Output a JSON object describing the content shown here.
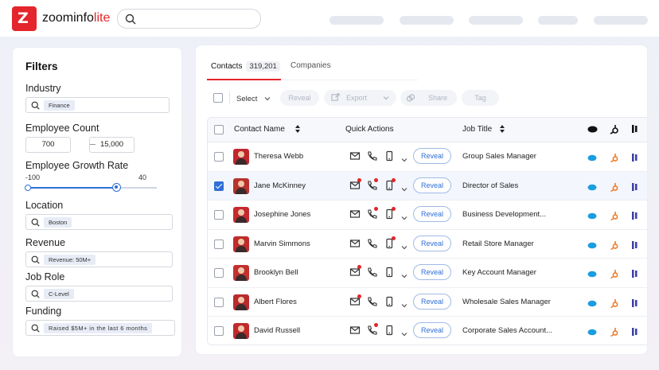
{
  "brand": {
    "name": "zoominfo",
    "suffix": "lite"
  },
  "colors": {
    "brand": "#e4252b",
    "accent": "#2f6fd6"
  },
  "filters": {
    "title": "Filters",
    "industry": {
      "label": "Industry",
      "value": "Finance"
    },
    "employee_count": {
      "label": "Employee Count",
      "min": "700",
      "max": "15,000"
    },
    "employee_growth": {
      "label": "Employee Growth Rate",
      "min_label": "-100",
      "max_label": "40"
    },
    "location": {
      "label": "Location",
      "value": "Boston"
    },
    "revenue": {
      "label": "Revenue",
      "value": "Revenue: 50M+"
    },
    "job_role": {
      "label": "Job Role",
      "value": "C-Level"
    },
    "funding": {
      "label": "Funding",
      "value": "Raised $5M+ in the last 6 months"
    }
  },
  "tabs": {
    "contacts_label": "Contacts",
    "contacts_count": "319,201",
    "companies_label": "Companies"
  },
  "toolbar": {
    "select_label": "Select",
    "reveal_label": "Reveal",
    "export_label": "Export",
    "share_label": "Share",
    "tag_label": "Tag"
  },
  "table": {
    "headers": {
      "contact_name": "Contact Name",
      "quick_actions": "Quick Actions",
      "job_title": "Job Title"
    },
    "reveal_label": "Reveal",
    "rows": [
      {
        "name": "Theresa Webb",
        "title": "Group Sales Manager",
        "checked": false
      },
      {
        "name": "Jane McKinney",
        "title": "Director of Sales",
        "checked": true
      },
      {
        "name": "Josephine Jones",
        "title": "Business Development...",
        "checked": false
      },
      {
        "name": "Marvin Simmons",
        "title": "Retail Store Manager",
        "checked": false
      },
      {
        "name": "Brooklyn Bell",
        "title": "Key Account Manager",
        "checked": false
      },
      {
        "name": "Albert Flores",
        "title": "Wholesale Sales Manager",
        "checked": false
      },
      {
        "name": "David Russell",
        "title": "Corporate Sales Account...",
        "checked": false
      }
    ]
  }
}
